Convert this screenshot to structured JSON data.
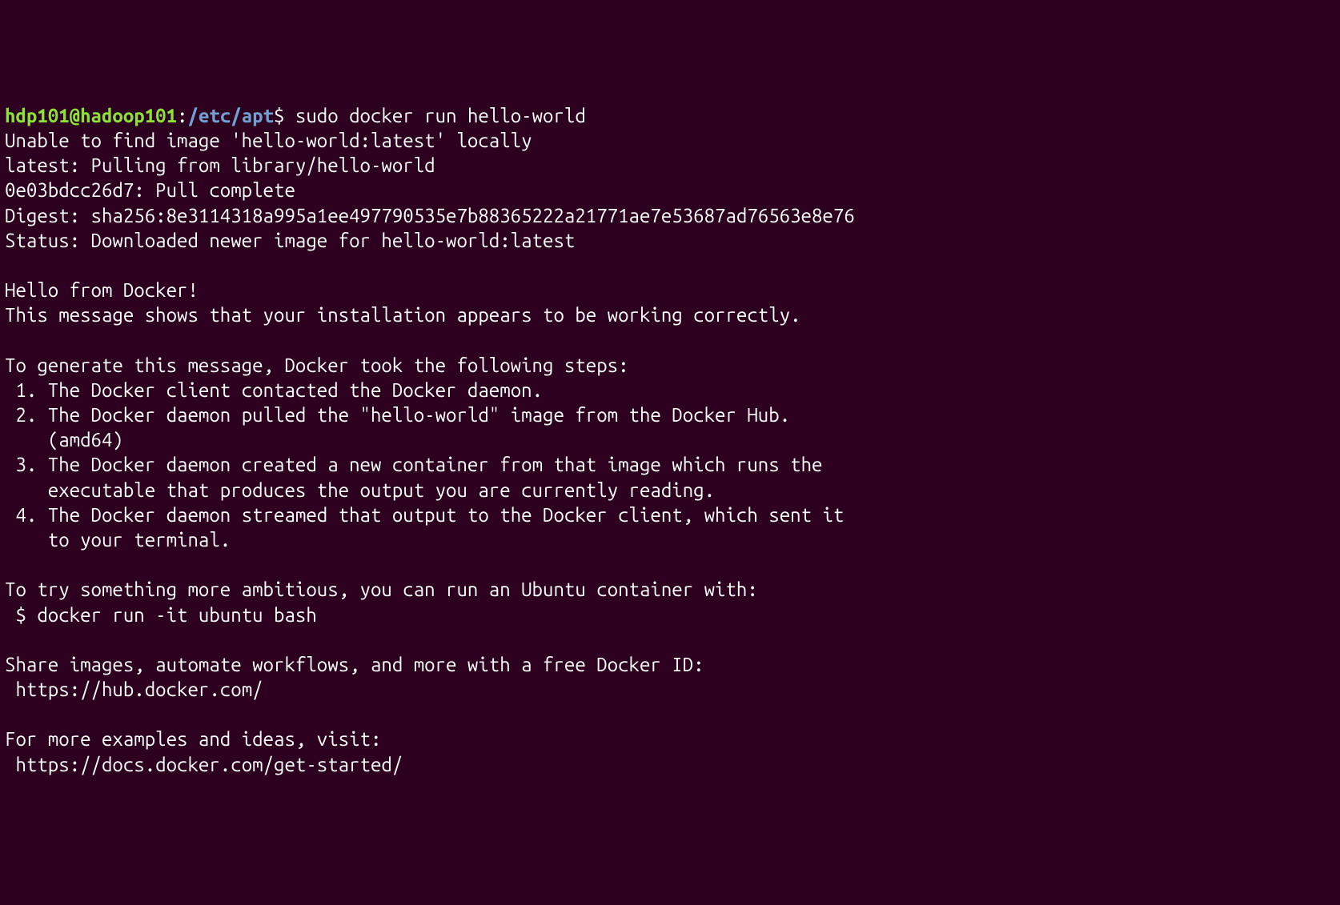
{
  "prompt": {
    "userhost": "hdp101@hadoop101",
    "colon": ":",
    "path": "/etc/apt",
    "dollar": "$ ",
    "command": "sudo docker run hello-world"
  },
  "output": {
    "lines": [
      "Unable to find image 'hello-world:latest' locally",
      "latest: Pulling from library/hello-world",
      "0e03bdcc26d7: Pull complete",
      "Digest: sha256:8e3114318a995a1ee497790535e7b88365222a21771ae7e53687ad76563e8e76",
      "Status: Downloaded newer image for hello-world:latest",
      "",
      "Hello from Docker!",
      "This message shows that your installation appears to be working correctly.",
      "",
      "To generate this message, Docker took the following steps:",
      " 1. The Docker client contacted the Docker daemon.",
      " 2. The Docker daemon pulled the \"hello-world\" image from the Docker Hub.",
      "    (amd64)",
      " 3. The Docker daemon created a new container from that image which runs the",
      "    executable that produces the output you are currently reading.",
      " 4. The Docker daemon streamed that output to the Docker client, which sent it",
      "    to your terminal.",
      "",
      "To try something more ambitious, you can run an Ubuntu container with:",
      " $ docker run -it ubuntu bash",
      "",
      "Share images, automate workflows, and more with a free Docker ID:",
      " https://hub.docker.com/",
      "",
      "For more examples and ideas, visit:",
      " https://docs.docker.com/get-started/"
    ]
  }
}
